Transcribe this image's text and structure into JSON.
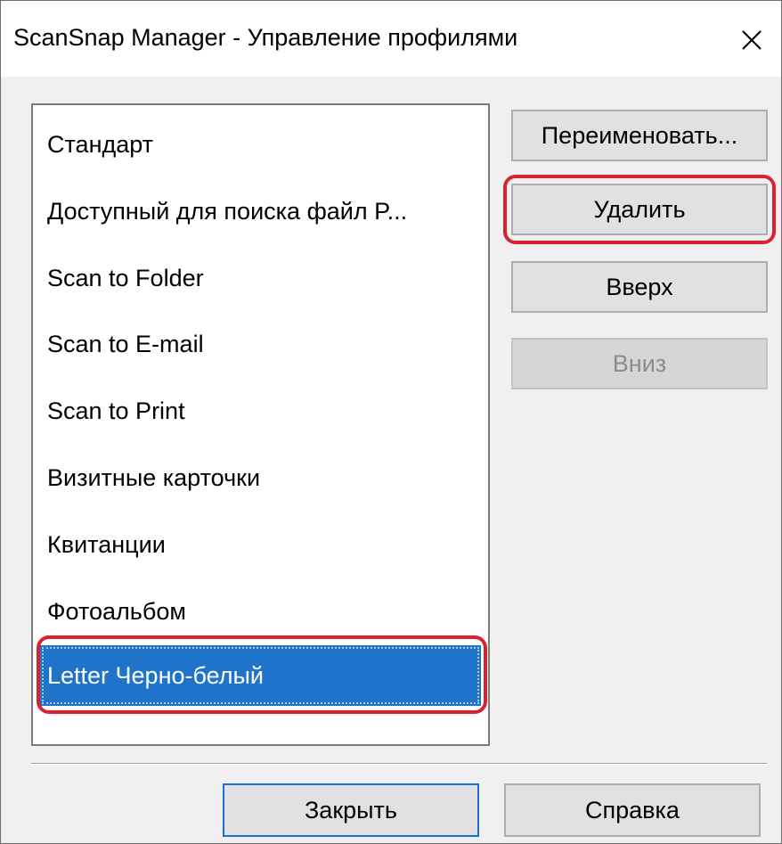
{
  "window": {
    "title": "ScanSnap Manager - Управление профилями"
  },
  "profiles": {
    "items": [
      "Стандарт",
      "Доступный для поиска файл P...",
      "Scan to Folder",
      "Scan to E-mail",
      "Scan to Print",
      "Визитные карточки",
      "Квитанции",
      "Фотоальбом",
      "Letter Черно-белый"
    ],
    "selected": "Letter Черно-белый"
  },
  "buttons": {
    "rename": "Переименовать...",
    "delete": "Удалить",
    "up": "Вверх",
    "down": "Вниз",
    "close": "Закрыть",
    "help": "Справка"
  },
  "colors": {
    "selection": "#1f73c8",
    "highlight": "#d8222f"
  }
}
